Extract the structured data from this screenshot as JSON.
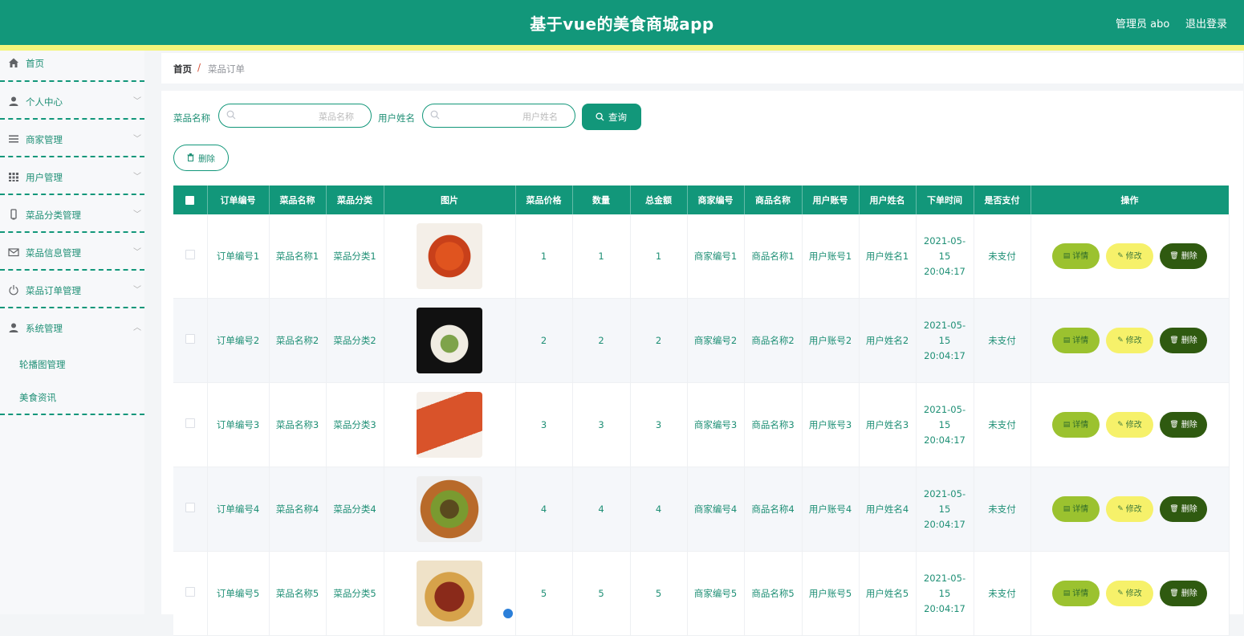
{
  "header": {
    "title": "基于vue的美食商城app",
    "user": "管理员 abo",
    "logout": "退出登录"
  },
  "sidebar": {
    "items": [
      {
        "label": "首页",
        "icon": "home-icon"
      },
      {
        "label": "个人中心",
        "icon": "user-icon"
      },
      {
        "label": "商家管理",
        "icon": "list-icon"
      },
      {
        "label": "用户管理",
        "icon": "grid-icon"
      },
      {
        "label": "菜品分类管理",
        "icon": "phone-icon"
      },
      {
        "label": "菜品信息管理",
        "icon": "mail-icon"
      },
      {
        "label": "菜品订单管理",
        "icon": "power-icon"
      },
      {
        "label": "系统管理",
        "icon": "user-icon"
      }
    ],
    "subitems": [
      "轮播图管理",
      "美食资讯"
    ]
  },
  "breadcrumb": {
    "home": "首页",
    "sep": "/",
    "current": "菜品订单"
  },
  "search": {
    "label1": "菜品名称",
    "placeholder1": "菜品名称",
    "label2": "用户姓名",
    "placeholder2": "用户姓名",
    "query": "查询"
  },
  "toolbar": {
    "delete": "删除"
  },
  "table": {
    "headers": [
      "订单编号",
      "菜品名称",
      "菜品分类",
      "图片",
      "菜品价格",
      "数量",
      "总金额",
      "商家编号",
      "商品名称",
      "用户账号",
      "用户姓名",
      "下单时间",
      "是否支付",
      "操作"
    ],
    "rows": [
      {
        "order": "订单编号1",
        "dish": "菜品名称1",
        "cat": "菜品分类1",
        "price": "1",
        "qty": "1",
        "total": "1",
        "shop": "商家编号1",
        "goods": "商品名称1",
        "account": "用户账号1",
        "uname": "用户姓名1",
        "time": "2021-05-15 20:04:17",
        "paid": "未支付"
      },
      {
        "order": "订单编号2",
        "dish": "菜品名称2",
        "cat": "菜品分类2",
        "price": "2",
        "qty": "2",
        "total": "2",
        "shop": "商家编号2",
        "goods": "商品名称2",
        "account": "用户账号2",
        "uname": "用户姓名2",
        "time": "2021-05-15 20:04:17",
        "paid": "未支付"
      },
      {
        "order": "订单编号3",
        "dish": "菜品名称3",
        "cat": "菜品分类3",
        "price": "3",
        "qty": "3",
        "total": "3",
        "shop": "商家编号3",
        "goods": "商品名称3",
        "account": "用户账号3",
        "uname": "用户姓名3",
        "time": "2021-05-15 20:04:17",
        "paid": "未支付"
      },
      {
        "order": "订单编号4",
        "dish": "菜品名称4",
        "cat": "菜品分类4",
        "price": "4",
        "qty": "4",
        "total": "4",
        "shop": "商家编号4",
        "goods": "商品名称4",
        "account": "用户账号4",
        "uname": "用户姓名4",
        "time": "2021-05-15 20:04:17",
        "paid": "未支付"
      },
      {
        "order": "订单编号5",
        "dish": "菜品名称5",
        "cat": "菜品分类5",
        "price": "5",
        "qty": "5",
        "total": "5",
        "shop": "商家编号5",
        "goods": "商品名称5",
        "account": "用户账号5",
        "uname": "用户姓名5",
        "time": "2021-05-15 20:04:17",
        "paid": "未支付"
      }
    ],
    "actions": {
      "detail": "详情",
      "edit": "修改",
      "delete": "删除"
    }
  },
  "colors": {
    "primary": "#12977a",
    "accent_strip": "#f4f47b",
    "text": "#1e8f75",
    "detail_btn": "#9bc22f",
    "edit_btn": "#f6f16a",
    "delete_btn": "#2f5a10"
  }
}
